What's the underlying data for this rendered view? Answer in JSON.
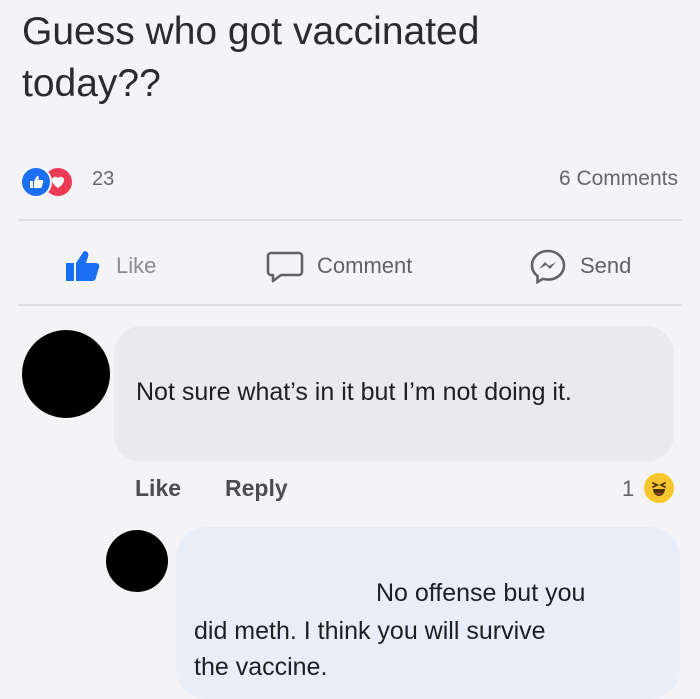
{
  "post": {
    "text_line1": "Guess who got vaccinated",
    "text_line2": "today??",
    "reaction_count": "23",
    "comments_count": "6 Comments",
    "reactions": [
      "like-reaction-icon",
      "love-reaction-icon"
    ]
  },
  "actions": {
    "like_label": "Like",
    "comment_label": "Comment",
    "send_label": "Send"
  },
  "comment1": {
    "text": "Not sure what’s in it but I’m not doing it.",
    "like_label": "Like",
    "reply_label": "Reply",
    "reaction_count": "1",
    "reaction_icon": "haha-reaction-icon"
  },
  "comment2": {
    "text_line1": "No offense but you",
    "text_line2": "did meth. I think you will survive",
    "text_line3": "the vaccine."
  },
  "colors": {
    "like_blue": "#1b6ff2",
    "love_red": "#ec3b55",
    "haha_yellow": "#f7c52c",
    "bubble_gray": "#e9e9ee",
    "reply_bubble_blue": "#e7eef8"
  }
}
